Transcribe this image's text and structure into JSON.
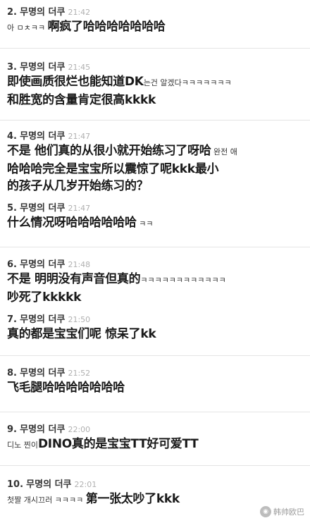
{
  "comments": [
    {
      "num": "2.",
      "name": "무명의 더쿠",
      "time": "21:42",
      "lines": [
        [
          {
            "t": "ko",
            "v": "아 ㅁㅊㅋㅋ "
          },
          {
            "t": "zh",
            "v": "啊疯了哈哈哈哈哈哈哈"
          }
        ]
      ]
    },
    {
      "num": "3.",
      "name": "무명의 더쿠",
      "time": "21:45",
      "lines": [
        [
          {
            "t": "zh",
            "v": "即使画质很烂也能知道DK"
          },
          {
            "t": "ko",
            "v": "는건 알겠다ㅋㅋㅋㅋㅋㅋㅋ"
          }
        ],
        [
          {
            "t": "zh",
            "v": "和胜宽的含量肯定很高kkkk"
          }
        ]
      ]
    },
    {
      "num": "4.",
      "name": "무명의 더쿠",
      "time": "21:47",
      "lines": [
        [
          {
            "t": "zh",
            "v": "不是 他们真的从很小就开始练习了呀哈"
          },
          {
            "t": "ko",
            "v": " 완전 애"
          }
        ],
        [
          {
            "t": "zh",
            "v": "哈哈哈完全是宝宝所以震惊了呢kkk最小"
          }
        ],
        [
          {
            "t": "zh",
            "v": "的孩子从几岁开始练习的？"
          }
        ]
      ]
    },
    {
      "num": "5.",
      "name": "무명의 더쿠",
      "time": "21:47",
      "lines": [
        [
          {
            "t": "zh",
            "v": " 什么情况呀哈哈哈哈哈哈"
          },
          {
            "t": "ko",
            "v": " ㅋㅋ"
          }
        ]
      ]
    },
    {
      "num": "6.",
      "name": "무명의 더쿠",
      "time": "21:48",
      "lines": [
        [
          {
            "t": "zh",
            "v": "不是 明明没有声音但真的"
          },
          {
            "t": "ko",
            "v": "ㅋㅋㅋㅋㅋㅋㅋㅋㅋㅋㅋㅋ"
          }
        ],
        [
          {
            "t": "zh",
            "v": "吵死了kkkkk"
          }
        ]
      ]
    },
    {
      "num": "7.",
      "name": "무명의 더쿠",
      "time": "21:50",
      "lines": [
        [
          {
            "t": "zh",
            "v": " 真的都是宝宝们呢 惊呆了kk"
          }
        ]
      ]
    },
    {
      "num": "8.",
      "name": "무명의 더쿠",
      "time": "21:52",
      "lines": [
        [
          {
            "t": "zh",
            "v": "飞毛腿哈哈哈哈哈哈哈"
          }
        ]
      ]
    },
    {
      "num": "9.",
      "name": "무명의 더쿠",
      "time": "22:00",
      "lines": [
        [
          {
            "t": "ko",
            "v": "디노 찐이"
          },
          {
            "t": "zh",
            "v": "DINO真的是宝宝TT好可爱TT"
          }
        ]
      ]
    },
    {
      "num": "10.",
      "name": "무명의 더쿠",
      "time": "22:01",
      "lines": [
        [
          {
            "t": "ko",
            "v": "첫짤 개시끄러 ㅋㅋㅋㅋ "
          },
          {
            "t": "zh",
            "v": "第一张太吵了kkk"
          }
        ]
      ]
    }
  ],
  "watermark": {
    "icon": "weibo-icon",
    "text": "韩帅欧巴"
  }
}
